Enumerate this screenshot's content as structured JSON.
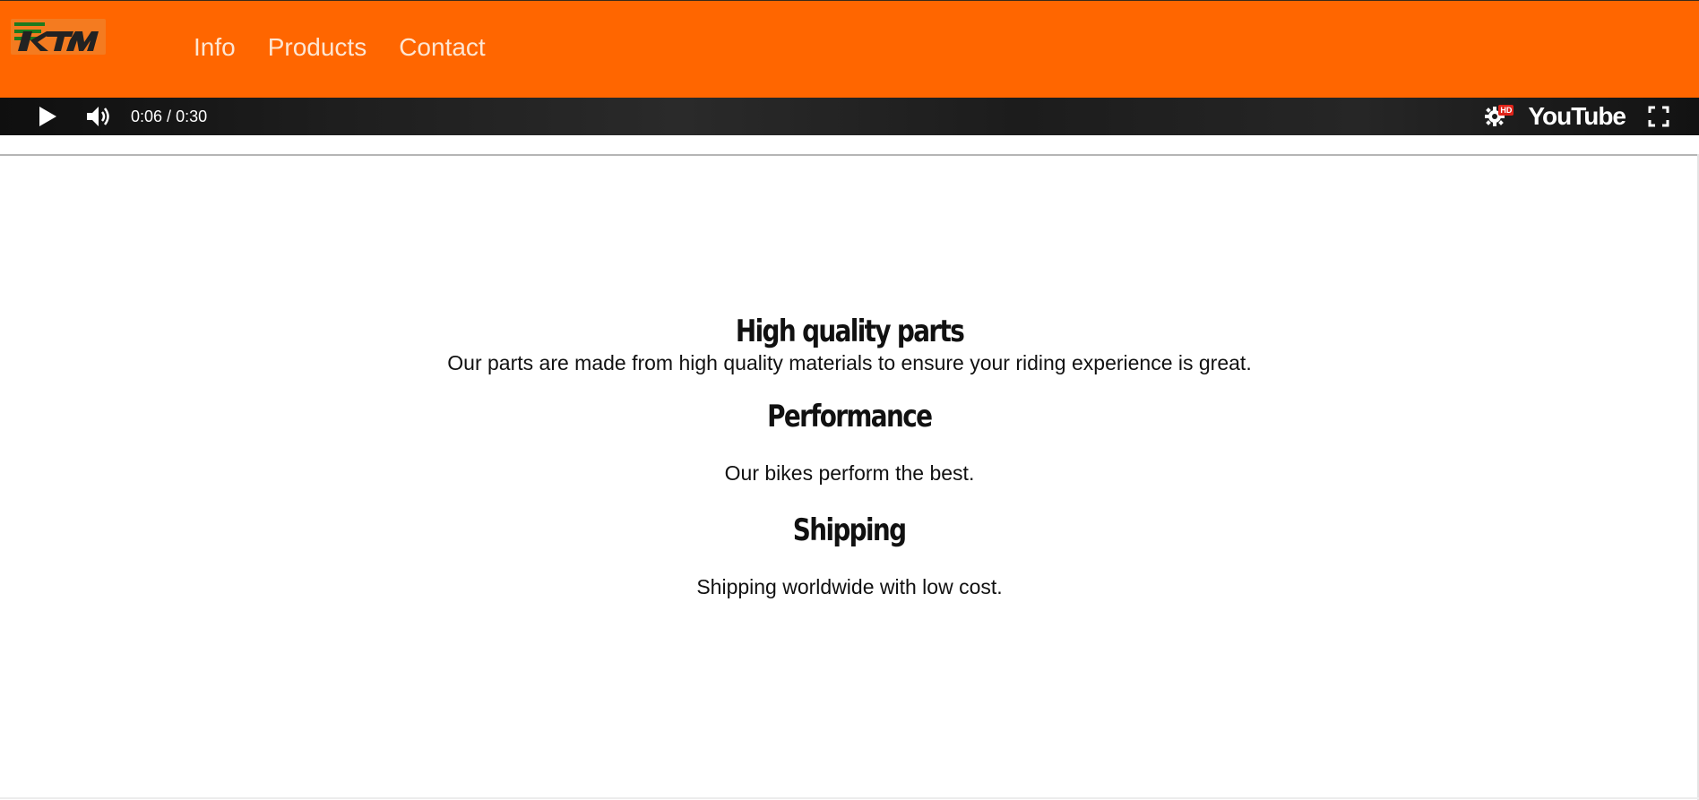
{
  "header": {
    "logo_text": "KTM",
    "nav": [
      {
        "label": "Info"
      },
      {
        "label": "Products"
      },
      {
        "label": "Contact"
      }
    ]
  },
  "player": {
    "current_time": "0:06",
    "separator": " / ",
    "duration": "0:30",
    "hd_badge": "HD",
    "brand": "YouTube"
  },
  "sections": [
    {
      "title": "High quality parts",
      "text": "Our parts are made from high quality materials to ensure your riding experience is great."
    },
    {
      "title": "Performance",
      "text": "Our bikes perform the best."
    },
    {
      "title": "Shipping",
      "text": "Shipping worldwide with low cost."
    }
  ],
  "colors": {
    "header_bg": "#ff6600",
    "nav_text": "#fde6d2",
    "logo_green": "#1e7a1e",
    "player_bg": "#1a1a1a",
    "hd_red": "#e0241a"
  },
  "icons": [
    "ktm-logo",
    "play-icon",
    "volume-icon",
    "settings-icon",
    "fullscreen-icon"
  ]
}
